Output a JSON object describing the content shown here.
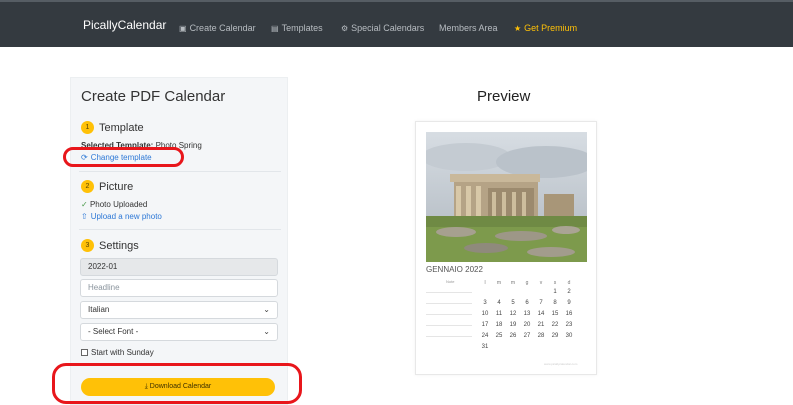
{
  "navbar": {
    "brand": "PicallyCalendar",
    "items": [
      {
        "label": "Create Calendar",
        "icon": "calendar-icon",
        "glyph": "▣"
      },
      {
        "label": "Templates",
        "icon": "file-icon",
        "glyph": "▤"
      },
      {
        "label": "Special Calendars",
        "icon": "gear-icon",
        "glyph": "⚙"
      },
      {
        "label": "Members Area",
        "icon": "",
        "glyph": ""
      },
      {
        "label": "Get Premium",
        "icon": "star-icon",
        "glyph": "★"
      }
    ]
  },
  "sidebar": {
    "title": "Create PDF Calendar",
    "template": {
      "num": "1",
      "label": "Template",
      "selected_prefix": "Selected Template:",
      "selected_value": "Photo Spring",
      "change_link": "Change template"
    },
    "picture": {
      "num": "2",
      "label": "Picture",
      "status": "Photo Uploaded",
      "upload_link": "Upload a new photo"
    },
    "settings": {
      "num": "3",
      "label": "Settings",
      "month_value": "2022-01",
      "headline_placeholder": "Headline",
      "language_value": "Italian",
      "font_value": "- Select Font -",
      "start_sunday_label": "Start with Sunday"
    },
    "download_label": "Download Calendar"
  },
  "preview": {
    "title": "Preview",
    "month_label": "GENNAIO 2022",
    "notes_header": "Note",
    "weekdays": [
      "l",
      "m",
      "m",
      "g",
      "v",
      "s",
      "d"
    ],
    "weeks": [
      [
        "",
        "",
        "",
        "",
        "",
        "1",
        "2"
      ],
      [
        "3",
        "4",
        "5",
        "6",
        "7",
        "8",
        "9"
      ],
      [
        "10",
        "11",
        "12",
        "13",
        "14",
        "15",
        "16"
      ],
      [
        "17",
        "18",
        "19",
        "20",
        "21",
        "22",
        "23"
      ],
      [
        "24",
        "25",
        "26",
        "27",
        "28",
        "29",
        "30"
      ],
      [
        "31",
        "",
        "",
        "",
        "",
        "",
        ""
      ]
    ],
    "footer": "www.picallycalendar.com"
  },
  "colors": {
    "navbar": "#343a40",
    "accent": "#ffc107",
    "link": "#2d78d6",
    "highlight": "#e8161b"
  }
}
